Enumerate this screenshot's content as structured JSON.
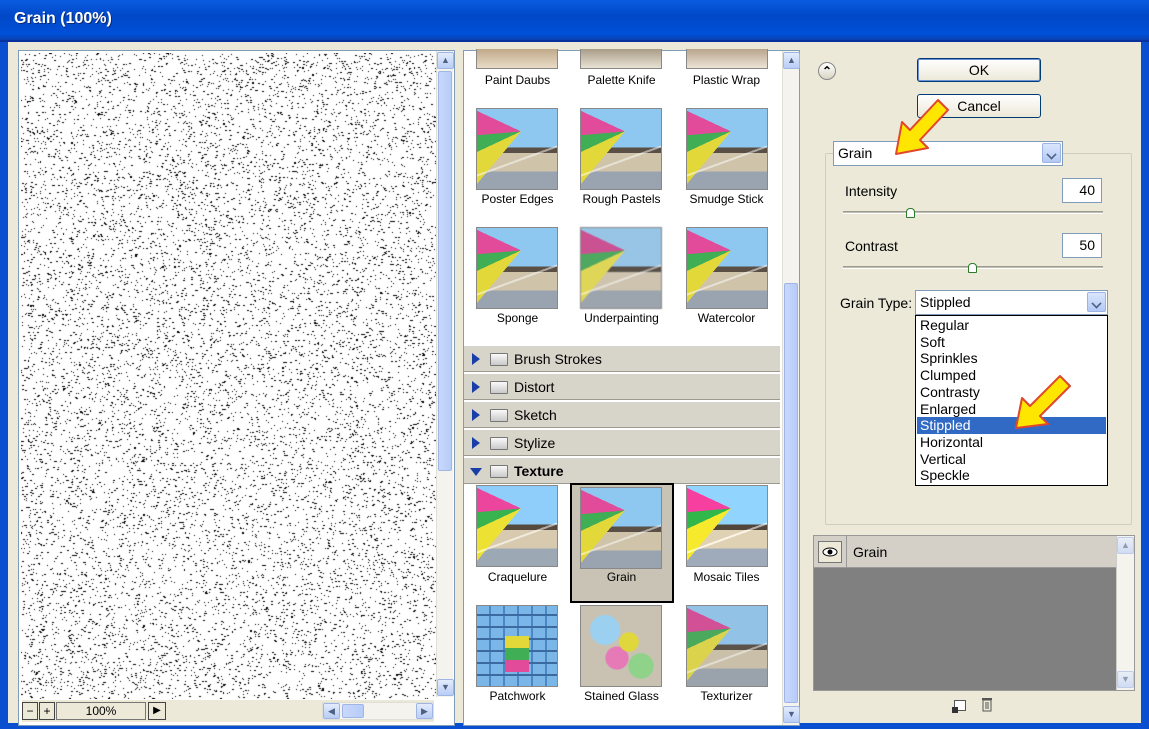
{
  "window": {
    "title": "Grain (100%)"
  },
  "preview": {
    "zoom": "100%",
    "zoom_out": "−",
    "zoom_in": "+",
    "menu_arrow": "▶"
  },
  "gallery": {
    "artistic_row1": [
      "Paint Daubs",
      "Palette Knife",
      "Plastic Wrap"
    ],
    "artistic_row2": [
      "Poster Edges",
      "Rough Pastels",
      "Smudge Stick"
    ],
    "artistic_row3": [
      "Sponge",
      "Underpainting",
      "Watercolor"
    ],
    "categories": [
      "Brush Strokes",
      "Distort",
      "Sketch",
      "Stylize"
    ],
    "open_category": "Texture",
    "texture_row1": [
      "Craquelure",
      "Grain",
      "Mosaic Tiles"
    ],
    "texture_row2": [
      "Patchwork",
      "Stained Glass",
      "Texturizer"
    ],
    "selected_filter": "Grain"
  },
  "buttons": {
    "ok": "OK",
    "cancel": "Cancel",
    "collapse": "⌃"
  },
  "settings": {
    "filter": "Grain",
    "intensity_label": "Intensity",
    "intensity_value": "40",
    "intensity_level": 40,
    "contrast_label": "Contrast",
    "contrast_value": "50",
    "contrast_level": 50,
    "grain_type_label": "Grain Type:",
    "grain_type_value": "Stippled",
    "grain_type_options": [
      "Regular",
      "Soft",
      "Sprinkles",
      "Clumped",
      "Contrasty",
      "Enlarged",
      "Stippled",
      "Horizontal",
      "Vertical",
      "Speckle"
    ]
  },
  "layers": {
    "items": [
      {
        "name": "Grain",
        "visible": true
      }
    ]
  },
  "colors": {
    "accent": "#316AC5",
    "title_bar": "#0A5CE0",
    "annotation_arrow": "#FFE600"
  },
  "icons": [
    "scroll-up-icon",
    "scroll-down-icon",
    "collapse-icon",
    "eye-icon",
    "new-layer-icon",
    "trash-icon",
    "folder-icon",
    "disclosure-triangle-icon",
    "highlight-arrow-icon"
  ]
}
